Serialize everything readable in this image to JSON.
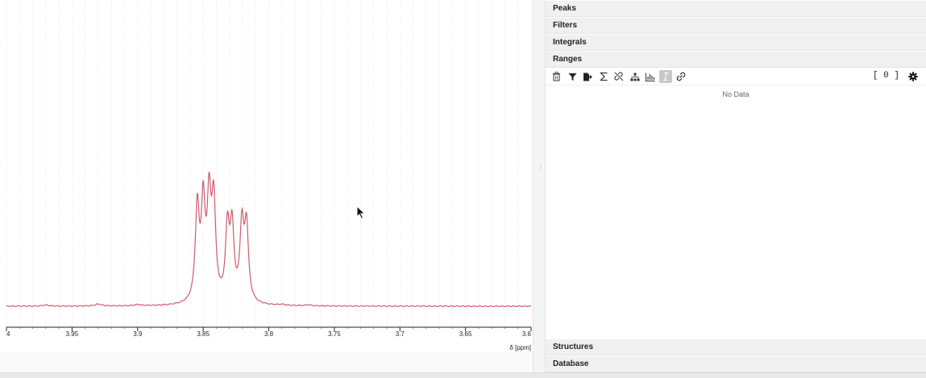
{
  "chart_data": {
    "type": "line",
    "xlabel": "δ [ppm]",
    "xlim": [
      4.0,
      3.6
    ],
    "x_reversed": true,
    "ticks": [
      {
        "value": 4.0,
        "label": "4"
      },
      {
        "value": 3.95,
        "label": "3.95"
      },
      {
        "value": 3.9,
        "label": "3.9"
      },
      {
        "value": 3.85,
        "label": "3.85"
      },
      {
        "value": 3.8,
        "label": "3.8"
      },
      {
        "value": 3.75,
        "label": "3.75"
      },
      {
        "value": 3.7,
        "label": "3.7"
      },
      {
        "value": 3.65,
        "label": "3.65"
      },
      {
        "value": 3.6,
        "label": "3.6"
      }
    ],
    "grid": true,
    "line_color": "#cf5b6b",
    "series": [
      {
        "peaks": [
          {
            "x": 3.8545,
            "height": 0.98
          },
          {
            "x": 3.85,
            "height": 0.98
          },
          {
            "x": 3.8455,
            "height": 1.0
          },
          {
            "x": 3.842,
            "height": 1.0
          },
          {
            "x": 3.8315,
            "height": 0.75
          },
          {
            "x": 3.828,
            "height": 0.75
          },
          {
            "x": 3.8205,
            "height": 0.78
          },
          {
            "x": 3.817,
            "height": 0.78
          }
        ],
        "bumps": [
          {
            "x": 3.97,
            "height": 0.012
          },
          {
            "x": 3.93,
            "height": 0.02
          },
          {
            "x": 3.9,
            "height": 0.012
          },
          {
            "x": 3.79,
            "height": 0.01
          },
          {
            "x": 3.77,
            "height": 0.01
          }
        ]
      }
    ]
  },
  "panels": {
    "peaks": "Peaks",
    "filters": "Filters",
    "integrals": "Integrals",
    "ranges": "Ranges",
    "structures": "Structures",
    "database": "Database"
  },
  "ranges": {
    "count": "[ 0 ]",
    "empty": "No Data",
    "toolbar": [
      {
        "name": "delete-icon"
      },
      {
        "name": "filter-icon"
      },
      {
        "name": "export-icon"
      },
      {
        "name": "sum-icon"
      },
      {
        "name": "unlink-icon"
      },
      {
        "name": "hierarchy-icon"
      },
      {
        "name": "chart-icon"
      },
      {
        "name": "italic-toggle-icon",
        "active": true
      },
      {
        "name": "link-icon"
      }
    ]
  }
}
